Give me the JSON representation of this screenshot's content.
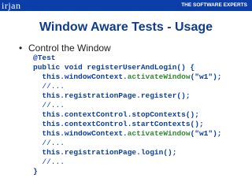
{
  "header": {
    "logo": "irjan",
    "tagline": "THE SOFTWARE EXPERTS",
    "bar_color": "#0b3ea8"
  },
  "slide": {
    "title": "Window Aware Tests - Usage",
    "bullet": "Control the Window",
    "code": {
      "annotation": "@Test",
      "signature": "public void registerUserAndLogin() {",
      "line1_obj": "this.windowContext.",
      "line1_method": "activateWindow",
      "line1_args": "(\"w1\");",
      "comment1": "//...",
      "line2": "this.registrationPage.register();",
      "comment2": "//...",
      "line3": "this.contextControl.stopContexts();",
      "line4": "this.contextControl.startContexts();",
      "line5_obj": "this.windowContext.",
      "line5_method": "activateWindow",
      "line5_args": "(\"w1\");",
      "comment3": "//...",
      "line6": "this.registrationPage.login();",
      "comment4": "//...",
      "closing": "}"
    }
  }
}
